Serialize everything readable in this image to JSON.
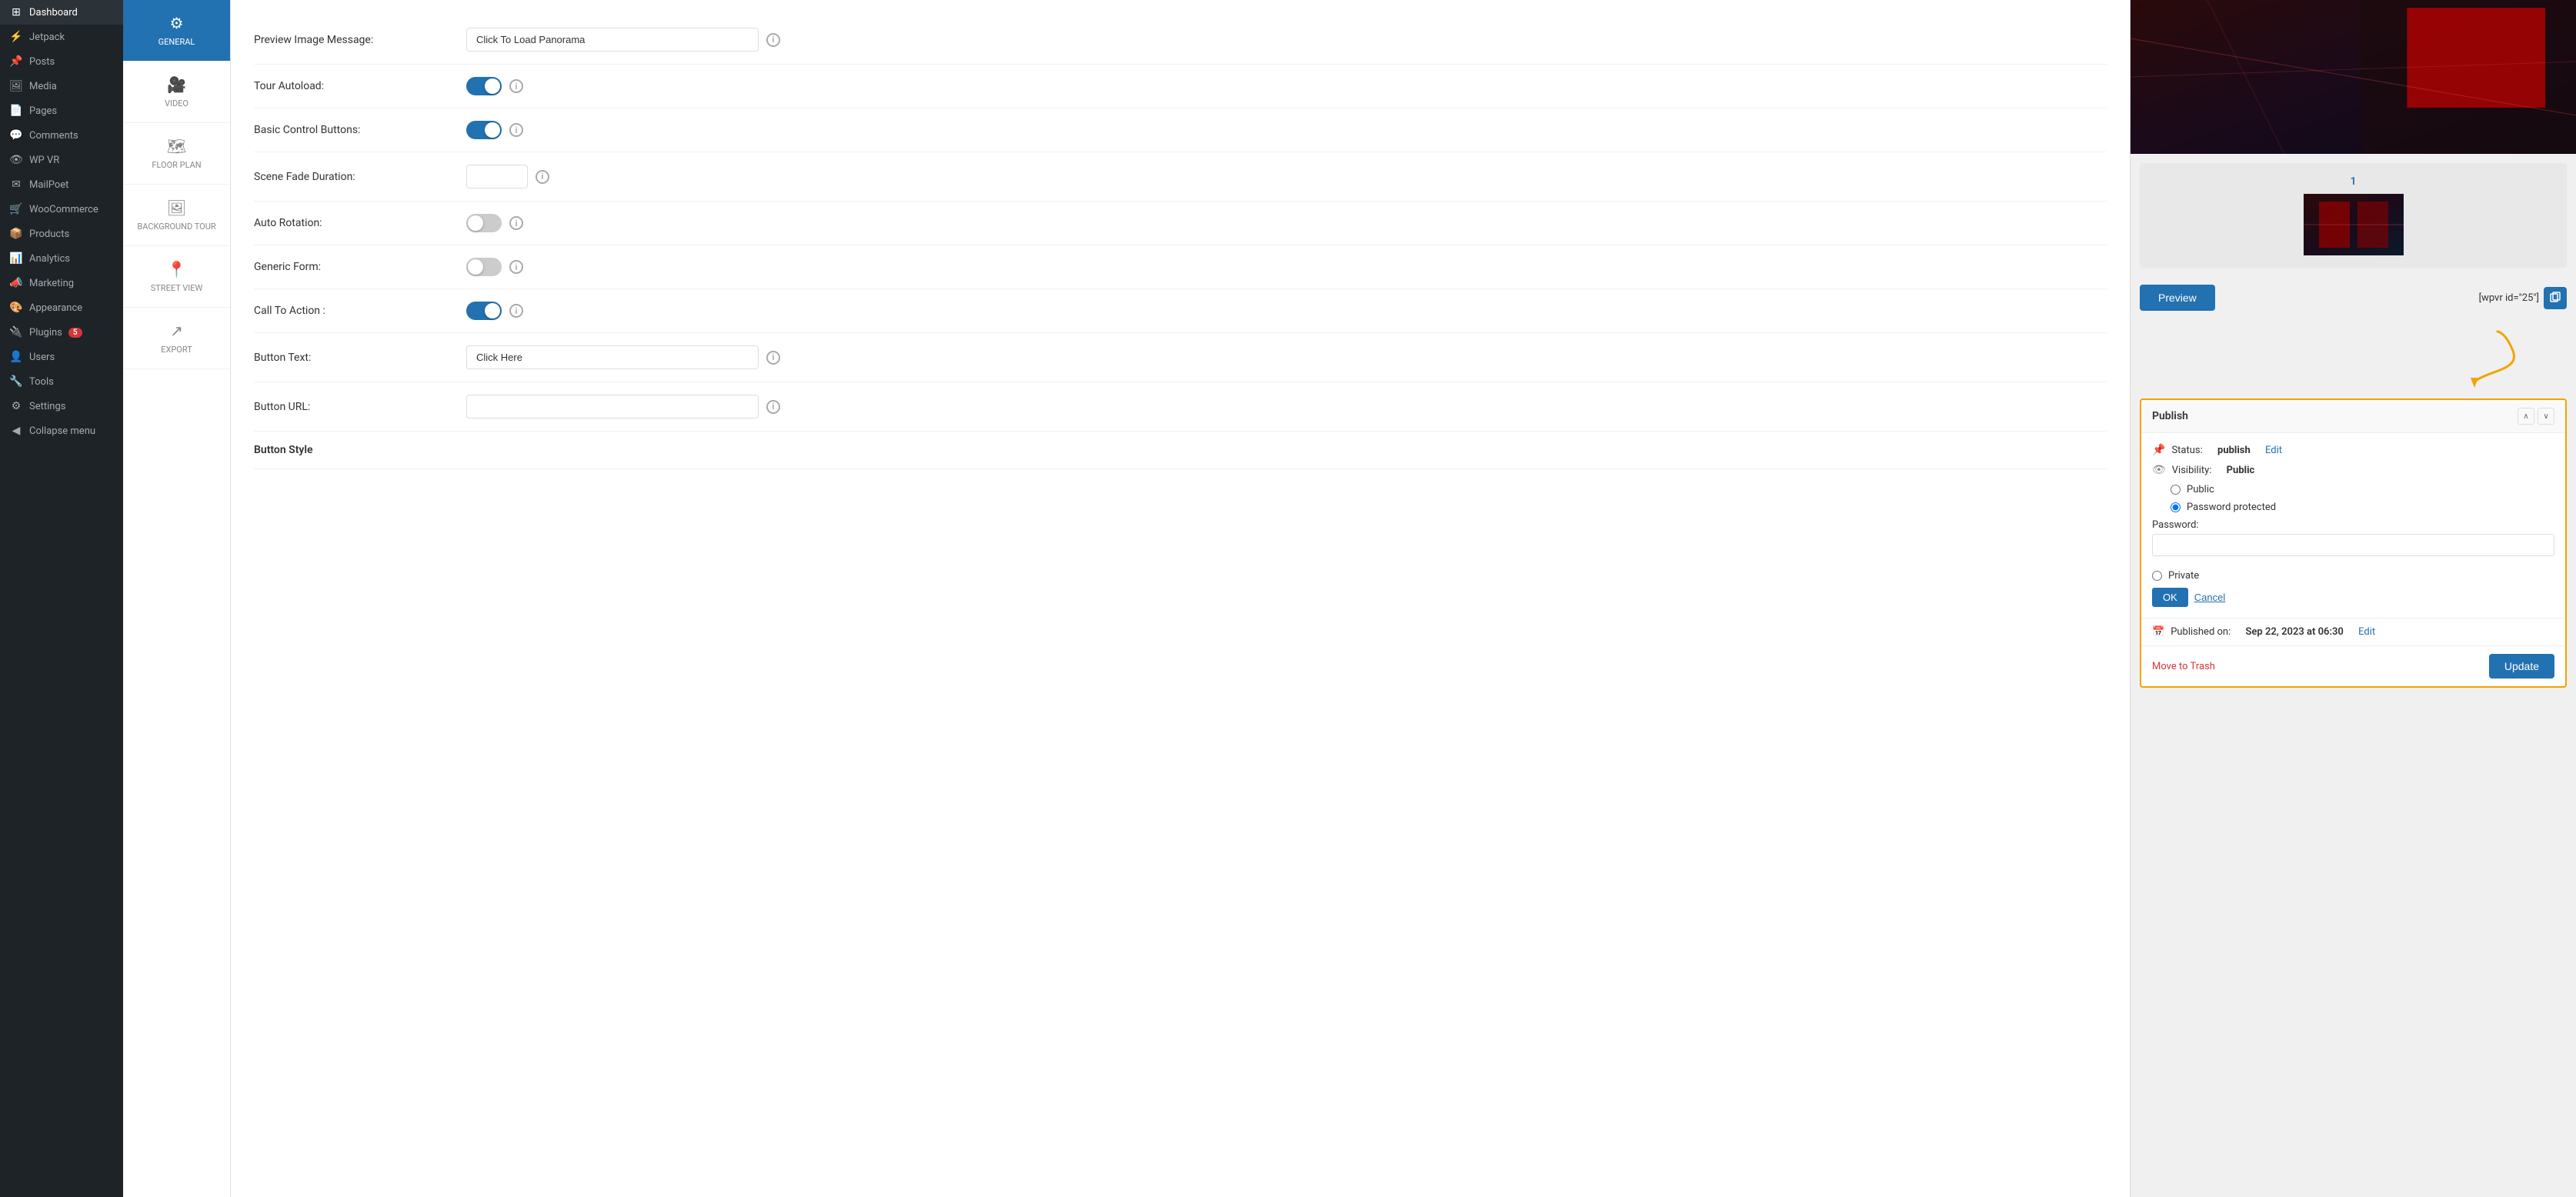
{
  "sidebar": {
    "items": [
      {
        "id": "dashboard",
        "label": "Dashboard",
        "icon": "⊞"
      },
      {
        "id": "jetpack",
        "label": "Jetpack",
        "icon": "⚡"
      },
      {
        "id": "posts",
        "label": "Posts",
        "icon": "📌"
      },
      {
        "id": "media",
        "label": "Media",
        "icon": "🖼"
      },
      {
        "id": "pages",
        "label": "Pages",
        "icon": "📄"
      },
      {
        "id": "comments",
        "label": "Comments",
        "icon": "💬"
      },
      {
        "id": "wpvr",
        "label": "WP VR",
        "icon": "👁"
      },
      {
        "id": "mailpoet",
        "label": "MailPoet",
        "icon": "✉"
      },
      {
        "id": "woocommerce",
        "label": "WooCommerce",
        "icon": "🛒"
      },
      {
        "id": "products",
        "label": "Products",
        "icon": "📦"
      },
      {
        "id": "analytics",
        "label": "Analytics",
        "icon": "📊"
      },
      {
        "id": "marketing",
        "label": "Marketing",
        "icon": "📣"
      },
      {
        "id": "appearance",
        "label": "Appearance",
        "icon": "🎨"
      },
      {
        "id": "plugins",
        "label": "Plugins",
        "icon": "🔌",
        "badge": "5"
      },
      {
        "id": "users",
        "label": "Users",
        "icon": "👤"
      },
      {
        "id": "tools",
        "label": "Tools",
        "icon": "🔧"
      },
      {
        "id": "settings",
        "label": "Settings",
        "icon": "⚙"
      },
      {
        "id": "collapse",
        "label": "Collapse menu",
        "icon": "◀"
      }
    ]
  },
  "sub_nav": {
    "items": [
      {
        "id": "general",
        "label": "GENERAL",
        "icon": "⚙",
        "active": true
      },
      {
        "id": "video",
        "label": "VIDEO",
        "icon": "🎥"
      },
      {
        "id": "floor_plan",
        "label": "FLOOR PLAN",
        "icon": "🗺"
      },
      {
        "id": "background_tour",
        "label": "BACKGROUND TOUR",
        "icon": "🖼"
      },
      {
        "id": "street_view",
        "label": "STREET VIEW",
        "icon": "📍"
      },
      {
        "id": "export",
        "label": "EXPORT",
        "icon": "↗"
      }
    ]
  },
  "form": {
    "fields": [
      {
        "id": "preview_image_message",
        "label": "Preview Image Message:",
        "type": "text",
        "value": "Click To Load Panorama",
        "placeholder": ""
      },
      {
        "id": "tour_autoload",
        "label": "Tour Autoload:",
        "type": "toggle",
        "value": true
      },
      {
        "id": "basic_control_buttons",
        "label": "Basic Control Buttons:",
        "type": "toggle",
        "value": true
      },
      {
        "id": "scene_fade_duration",
        "label": "Scene Fade Duration:",
        "type": "text_sm",
        "value": ""
      },
      {
        "id": "auto_rotation",
        "label": "Auto Rotation:",
        "type": "toggle",
        "value": false
      },
      {
        "id": "generic_form",
        "label": "Generic Form:",
        "type": "toggle",
        "value": false
      },
      {
        "id": "call_to_action",
        "label": "Call To Action :",
        "type": "toggle",
        "value": true
      },
      {
        "id": "button_text",
        "label": "Button Text:",
        "type": "text",
        "value": "Click Here",
        "placeholder": ""
      },
      {
        "id": "button_url",
        "label": "Button URL:",
        "type": "text",
        "value": "",
        "placeholder": ""
      },
      {
        "id": "button_style",
        "label": "Button Style",
        "type": "header"
      }
    ]
  },
  "right_panel": {
    "thumbnail_number": "1",
    "preview_button_label": "Preview",
    "shortcode_text": "[wpvr id=\"25\"]",
    "arrow_color": "#f0a500",
    "publish_box": {
      "title": "Publish",
      "status_label": "Status:",
      "status_value": "publish",
      "status_edit_label": "Edit",
      "visibility_label": "Visibility:",
      "visibility_value": "Public",
      "radio_options": [
        {
          "id": "radio_public",
          "label": "Public",
          "checked": false
        },
        {
          "id": "radio_password",
          "label": "Password protected",
          "checked": true
        },
        {
          "id": "radio_private",
          "label": "Private",
          "checked": false
        }
      ],
      "password_label": "Password:",
      "password_placeholder": "",
      "ok_label": "OK",
      "cancel_label": "Cancel",
      "published_on_label": "Published on:",
      "published_on_value": "Sep 22, 2023 at 06:30",
      "published_on_edit_label": "Edit",
      "move_to_trash_label": "Move to Trash",
      "update_label": "Update"
    }
  }
}
